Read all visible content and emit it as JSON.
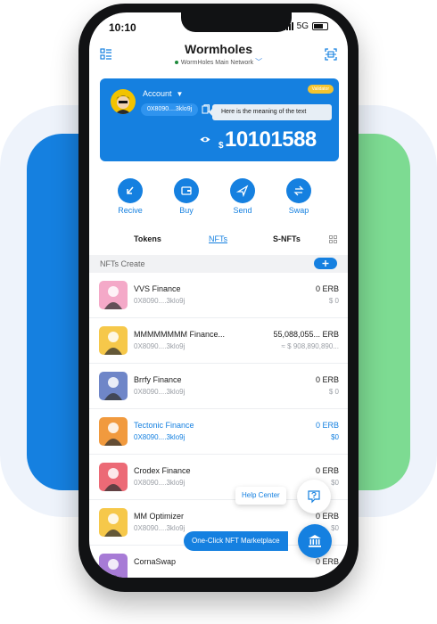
{
  "status": {
    "time": "10:10",
    "network": "5G"
  },
  "header": {
    "title": "Wormholes",
    "network": "WormHoles Main Network",
    "menu_icon": "menu-icon",
    "scan_icon": "scan-icon"
  },
  "account": {
    "label": "Account",
    "address": "0X8090....3klo9j",
    "tooltip": "Here is the meaning of the text",
    "badge": "Validator",
    "currency": "$",
    "balance": "10101588"
  },
  "actions": [
    {
      "label": "Recive",
      "icon": "receive-icon"
    },
    {
      "label": "Buy",
      "icon": "wallet-icon"
    },
    {
      "label": "Send",
      "icon": "send-icon"
    },
    {
      "label": "Swap",
      "icon": "swap-icon"
    }
  ],
  "tabs": [
    {
      "label": "Tokens",
      "active": false
    },
    {
      "label": "NFTs",
      "active": true
    },
    {
      "label": "S-NFTs",
      "active": false
    }
  ],
  "section": {
    "label": "NFTs Create"
  },
  "nfts": [
    {
      "name": "VVS Finance",
      "address": "0X8090....3klo9j",
      "amount": "0 ERB",
      "usd": "$ 0",
      "color": "#f4a9c8"
    },
    {
      "name": "MMMMMMMM Finance...",
      "address": "0X8090....3klo9j",
      "amount": "55,088,055... ERB",
      "usd": "≈ $ 908,890,890...",
      "color": "#f6c84a"
    },
    {
      "name": "Brrfy Finance",
      "address": "0X8090....3klo9j",
      "amount": "0 ERB",
      "usd": "$ 0",
      "color": "#6f86c8"
    },
    {
      "name": "Tectonic Finance",
      "address": "0X8090....3klo9j",
      "amount": "0 ERB",
      "usd": "$0",
      "color": "#f19a3e",
      "highlight": true
    },
    {
      "name": "Crodex Finance",
      "address": "0X8090....3klo9j",
      "amount": "0 ERB",
      "usd": "$0",
      "color": "#ec6a76"
    },
    {
      "name": "MM Optimizer",
      "address": "0X8090....3klo9j",
      "amount": "0 ERB",
      "usd": "$0",
      "color": "#f6c84a"
    },
    {
      "name": "CornaSwap",
      "address": "",
      "amount": "0 ERB",
      "usd": "",
      "color": "#a77bd6"
    }
  ],
  "help": {
    "label": "Help Center"
  },
  "marketplace": {
    "label": "One-Click NFT Marketplace"
  }
}
